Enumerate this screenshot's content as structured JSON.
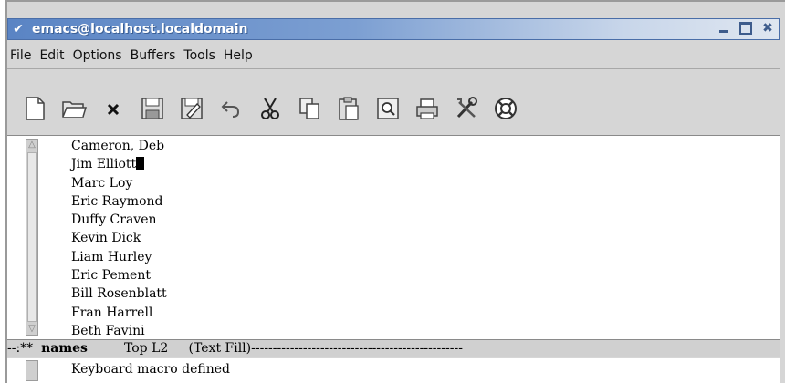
{
  "window": {
    "title": "emacs@localhost.localdomain"
  },
  "menu": {
    "items": [
      "File",
      "Edit",
      "Options",
      "Buffers",
      "Tools",
      "Help"
    ]
  },
  "toolbar": {
    "icons": [
      "new-file-icon",
      "open-folder-icon",
      "close-x-icon",
      "save-disk-icon",
      "save-as-disk-icon",
      "undo-icon",
      "cut-scissors-icon",
      "copy-icon",
      "paste-icon",
      "search-icon",
      "print-icon",
      "preferences-tools-icon",
      "help-lifebuoy-icon"
    ]
  },
  "buffer": {
    "lines": [
      "Cameron, Deb",
      "Jim Elliott",
      "Marc Loy",
      "Eric Raymond",
      "Duffy Craven",
      "Kevin Dick",
      "Liam Hurley",
      "Eric Pement",
      "Bill Rosenblatt",
      "Fran Harrell",
      "Beth Favini"
    ],
    "cursor_line": 1
  },
  "modeline": {
    "prefix": "--:**  ",
    "buffer_name": "names",
    "position": "         Top L2     ",
    "mode": "(Text Fill)",
    "fill": "-------------------------------------------------"
  },
  "echo": {
    "message": "Keyboard macro defined"
  },
  "colors": {
    "titlebar_start": "#5a84c4",
    "window_bg": "#d6d6d6",
    "modeline_bg": "#d0d0d0"
  }
}
